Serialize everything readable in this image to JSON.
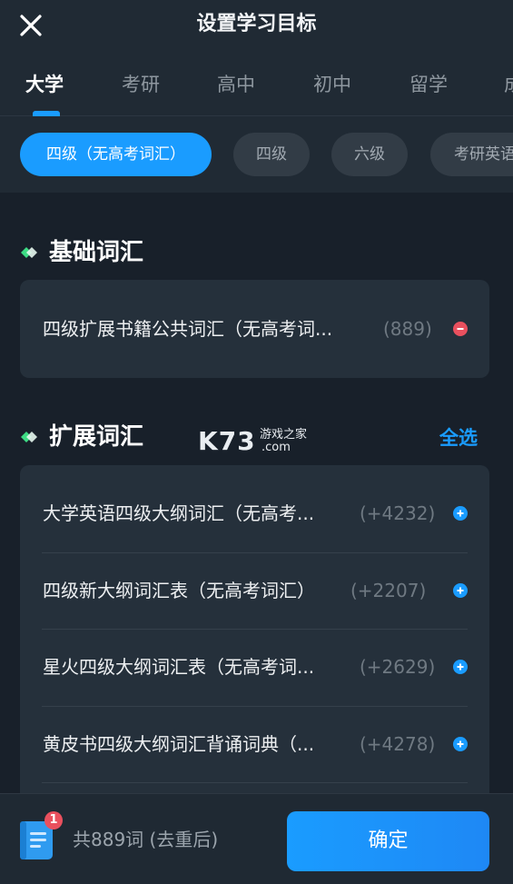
{
  "header": {
    "title": "设置学习目标",
    "close_icon": "close-icon"
  },
  "tabs": [
    {
      "label": "大学",
      "active": true
    },
    {
      "label": "考研",
      "active": false
    },
    {
      "label": "高中",
      "active": false
    },
    {
      "label": "初中",
      "active": false
    },
    {
      "label": "留学",
      "active": false
    },
    {
      "label": "成",
      "active": false
    }
  ],
  "chips": [
    {
      "label": "四级（无高考词汇）",
      "active": true
    },
    {
      "label": "四级",
      "active": false
    },
    {
      "label": "六级",
      "active": false
    },
    {
      "label": "考研英语",
      "active": false
    }
  ],
  "basic_section": {
    "title": "基础词汇",
    "items": [
      {
        "name": "四级扩展书籍公共词汇（无高考词...",
        "count": "(889)",
        "action_icon": "minus-circle-icon"
      }
    ]
  },
  "extended_section": {
    "title": "扩展词汇",
    "select_all": "全选",
    "items": [
      {
        "name": "大学英语四级大纲词汇（无高考...",
        "count": "(+4232)",
        "action_icon": "plus-circle-icon"
      },
      {
        "name": "四级新大纲词汇表（无高考词汇）",
        "count": "(+2207)",
        "action_icon": "plus-circle-icon"
      },
      {
        "name": "星火四级大纲词汇表（无高考词...",
        "count": "(+2629)",
        "action_icon": "plus-circle-icon"
      },
      {
        "name": "黄皮书四级大纲词汇背诵词典（...",
        "count": "(+4278)",
        "action_icon": "plus-circle-icon"
      }
    ]
  },
  "watermark": {
    "logo_text": "K73",
    "sub_text": "游戏之家",
    "domain": ".com"
  },
  "footer": {
    "badge": "1",
    "total": "共889词 (去重后)",
    "confirm": "确定"
  },
  "colors": {
    "accent": "#1a9cff",
    "danger": "#e9505e",
    "background": "#18202a",
    "card": "#25303b"
  }
}
